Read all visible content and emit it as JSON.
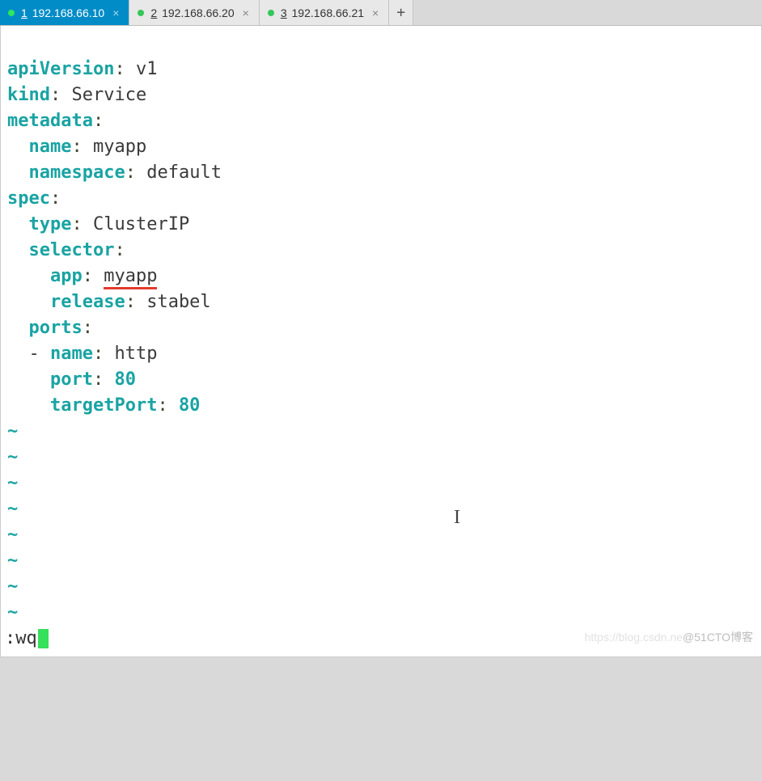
{
  "tabs": [
    {
      "num": "1",
      "label": "192.168.66.10",
      "active": true
    },
    {
      "num": "2",
      "label": "192.168.66.20",
      "active": false
    },
    {
      "num": "3",
      "label": "192.168.66.21",
      "active": false
    }
  ],
  "newtab_glyph": "+",
  "close_glyph": "×",
  "yaml": {
    "l1_k": "apiVersion",
    "l1_v": "v1",
    "l2_k": "kind",
    "l2_v": "Service",
    "l3_k": "metadata",
    "l4_k": "name",
    "l4_v": "myapp",
    "l5_k": "namespace",
    "l5_v": "default",
    "l6_k": "spec",
    "l7_k": "type",
    "l7_v": "ClusterIP",
    "l8_k": "selector",
    "l9_k": "app",
    "l9_v": "myapp",
    "l10_k": "release",
    "l10_v": "stabel",
    "l11_k": "ports",
    "l12_dash": "-",
    "l12_k": "name",
    "l12_v": "http",
    "l13_k": "port",
    "l13_v": "80",
    "l14_k": "targetPort",
    "l14_v": "80"
  },
  "tilde": "~",
  "command": ":wq",
  "ibeam": "I",
  "watermark_faint": "https://blog.csdn.ne",
  "watermark_main": "@51CTO博客"
}
